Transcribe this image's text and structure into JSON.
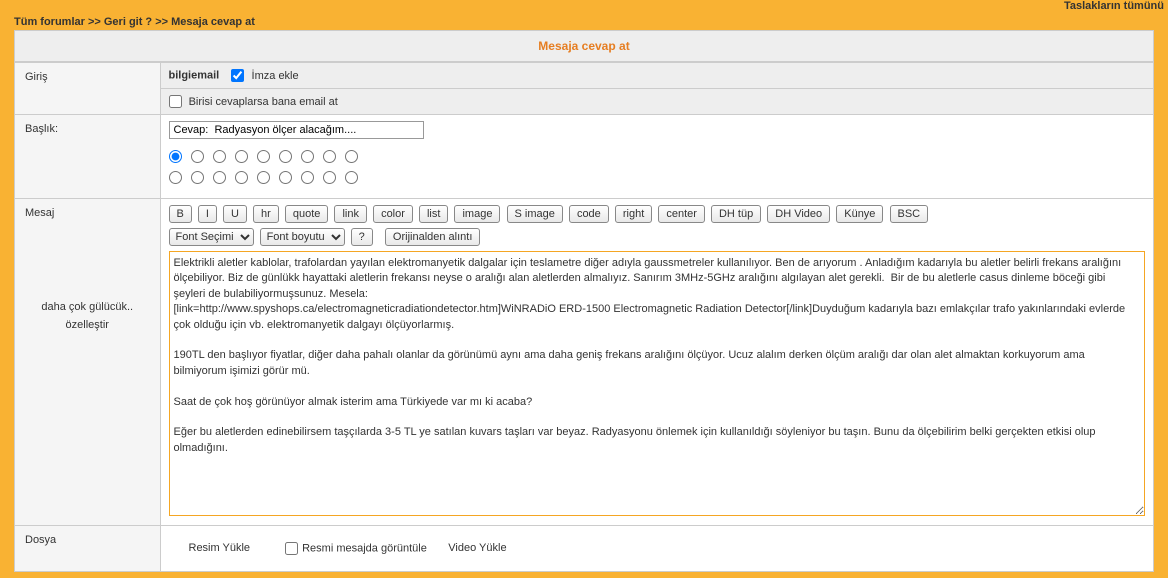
{
  "topLink": "Taslakların tümünü",
  "breadcrumb": {
    "all": "Tüm forumlar",
    "sep1": " >> ",
    "back": "Geri git ?",
    "sep2": " >> ",
    "current": "Mesaja cevap at"
  },
  "pageTitle": "Mesaja cevap at",
  "labels": {
    "login": "Giriş",
    "title": "Başlık:",
    "msg": "Mesaj",
    "msgSub1": "daha çok gülücük..",
    "msgSub2": "özelleştir",
    "file": "Dosya"
  },
  "entry": {
    "user": "bilgiemail",
    "addSign": "İmza ekle",
    "emailNotify": "Birisi cevaplarsa bana email at"
  },
  "titleInput": "Cevap:  Radyasyon ölçer alacağım....",
  "toolbar": {
    "b": "B",
    "i": "I",
    "u": "U",
    "hr": "hr",
    "quote": "quote",
    "link": "link",
    "color": "color",
    "list": "list",
    "image": "image",
    "simage": "S image",
    "code": "code",
    "right": "right",
    "center": "center",
    "dhtup": "DH tüp",
    "dhvideo": "DH Video",
    "kunye": "Künye",
    "bsc": "BSC",
    "fontSel": "Font Seçimi",
    "fontSize": "Font boyutu",
    "help": "?",
    "orig": "Orijinalden alıntı"
  },
  "msgBody": "Elektrikli aletler kablolar, trafolardan yayılan elektromanyetik dalgalar için teslametre diğer adıyla gaussmetreler kullanılıyor. Ben de arıyorum . Anladığım kadarıyla bu aletler belirli frekans aralığını ölçebiliyor. Biz de günlükk hayattaki aletlerin frekansı neyse o aralığı alan aletlerden almalıyız. Sanırım 3MHz-5GHz aralığını algılayan alet gerekli.  Bir de bu aletlerle casus dinleme böceği gibi şeyleri de bulabiliyormuşsunuz. Mesela:\n[link=http://www.spyshops.ca/electromagneticradiationdetector.htm]WiNRADiO ERD-1500 Electromagnetic Radiation Detector[/link]Duyduğum kadarıyla bazı emlakçılar trafo yakınlarındaki evlerde çok olduğu için vb. elektromanyetik dalgayı ölçüyorlarmış.\n\n190TL den başlıyor fiyatlar, diğer daha pahalı olanlar da görünümü aynı ama daha geniş frekans aralığını ölçüyor. Ucuz alalım derken ölçüm aralığı dar olan alet almaktan korkuyorum ama bilmiyorum işimizi görür mü.\n\nSaat de çok hoş görünüyor almak isterim ama Türkiyede var mı ki acaba?\n\nEğer bu aletlerden edinebilirsem taşçılarda 3-5 TL ye satılan kuvars taşları var beyaz. Radyasyonu önlemek için kullanıldığı söyleniyor bu taşın. Bunu da ölçebilirim belki gerçekten etkisi olup olmadığını.",
  "dosya": {
    "resimYukle": "Resim Yükle",
    "showInMsg": "Resmi mesajda görüntüle",
    "videoYukle": "Video Yükle"
  }
}
